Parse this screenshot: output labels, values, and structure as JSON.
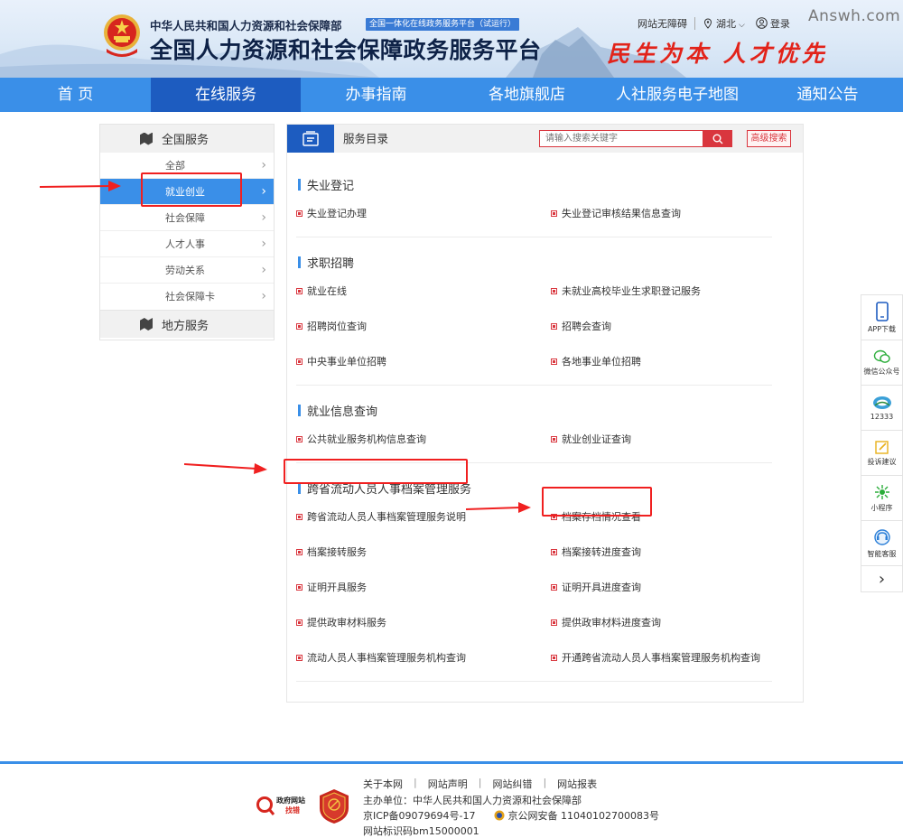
{
  "header": {
    "org_name": "中华人民共和国人力资源和社会保障部",
    "beta_tag": "全国一体化在线政务服务平台（试运行）",
    "site_title": "全国人力资源和社会保障政务服务平台",
    "slogan": "民生为本 人才优先",
    "accessible_link": "网站无障碍",
    "region": "湖北",
    "login": "登录",
    "watermark": "Answh.com"
  },
  "nav": {
    "items": [
      "首 页",
      "在线服务",
      "办事指南",
      "各地旗舰店",
      "人社服务电子地图",
      "通知公告"
    ],
    "active_index": 1
  },
  "sidebar": {
    "national_title": "全国服务",
    "items": [
      {
        "label": "全部"
      },
      {
        "label": "就业创业"
      },
      {
        "label": "社会保障"
      },
      {
        "label": "人才人事"
      },
      {
        "label": "劳动关系"
      },
      {
        "label": "社会保障卡"
      }
    ],
    "active_index": 1,
    "local_title": "地方服务"
  },
  "panel": {
    "title": "服务目录",
    "search_placeholder": "请输入搜索关键字",
    "advanced_search": "高级搜索",
    "sections": [
      {
        "title": "失业登记",
        "items": [
          "失业登记办理",
          "失业登记审核结果信息查询"
        ]
      },
      {
        "title": "求职招聘",
        "items": [
          "就业在线",
          "未就业高校毕业生求职登记服务",
          "招聘岗位查询",
          "招聘会查询",
          "中央事业单位招聘",
          "各地事业单位招聘"
        ]
      },
      {
        "title": "就业信息查询",
        "items": [
          "公共就业服务机构信息查询",
          "就业创业证查询"
        ]
      },
      {
        "title": "跨省流动人员人事档案管理服务",
        "items": [
          "跨省流动人员人事档案管理服务说明",
          "档案存档情况查看",
          "档案接转服务",
          "档案接转进度查询",
          "证明开具服务",
          "证明开具进度查询",
          "提供政审材料服务",
          "提供政审材料进度查询",
          "流动人员人事档案管理服务机构查询",
          "开通跨省流动人员人事档案管理服务机构查询"
        ]
      }
    ]
  },
  "floatbar": {
    "items": [
      "APP下载",
      "微信公众号",
      "12333",
      "投诉建议",
      "小程序",
      "智能客服"
    ]
  },
  "footer": {
    "links": [
      "关于本网",
      "网站声明",
      "网站纠错",
      "网站报表"
    ],
    "sponsor": "主办单位：中华人民共和国人力资源和社会保障部",
    "icp": "京ICP备09079694号-17",
    "police": "京公网安备 11040102700083号",
    "site_code": "网站标识码bm15000001",
    "badge_text": "政府网站找错",
    "badge_line1": "政府网站",
    "badge_line2": "找错"
  },
  "colors": {
    "nav_blue": "#3a8fe8",
    "nav_active": "#1d5cc0",
    "accent_red": "#d9363e",
    "annotation_red": "#f02020"
  }
}
